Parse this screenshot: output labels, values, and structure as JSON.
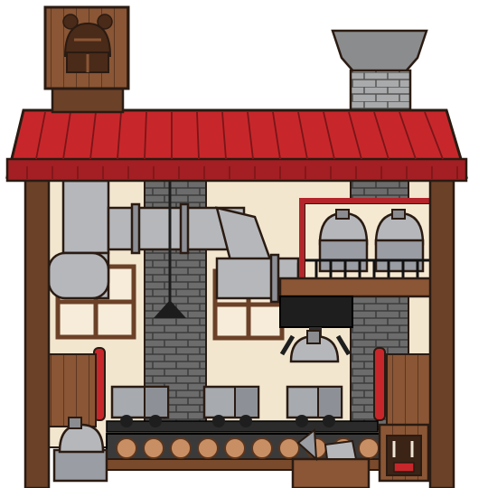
{
  "scene": {
    "title": "",
    "palette": {
      "wall": "#f3e6cf",
      "wood_dark": "#6b4128",
      "wood_mid": "#8a5635",
      "wood_light": "#a46a43",
      "roof_red": "#c7272b",
      "roof_dark": "#8f1b1e",
      "stone": "#6c6c6c",
      "stone_dark": "#4a4a4a",
      "pipe": "#b5b7bb",
      "pipe_dark": "#7b7e84",
      "metal_black": "#222222",
      "log": "#c98f64",
      "outline": "#2a1b12"
    },
    "icons": {
      "smoke_stack": "chimney-icon",
      "signboard": "helmet-sign-icon",
      "claw": "claw-grabber-icon"
    },
    "helmets_on_shelf": 2,
    "carts_on_rail": 3
  }
}
